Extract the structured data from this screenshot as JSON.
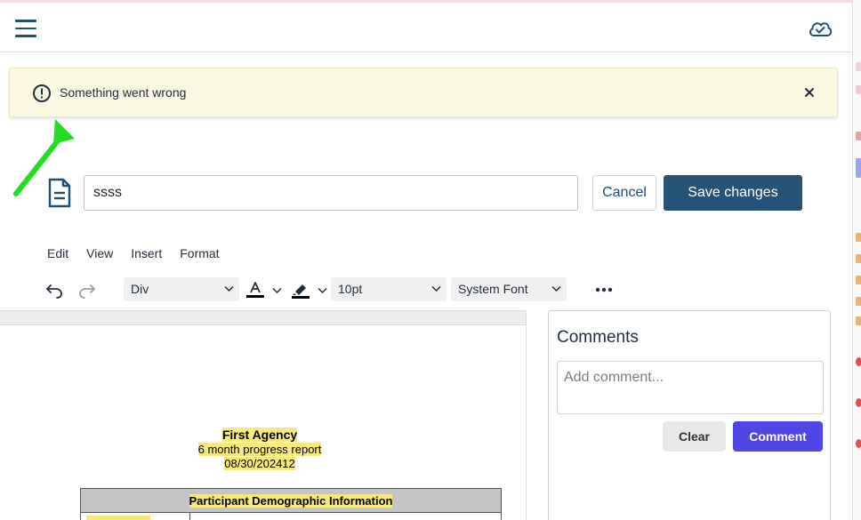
{
  "alert": {
    "message": "Something went wrong"
  },
  "editor": {
    "title_value": "ssss",
    "cancel_label": "Cancel",
    "save_label": "Save changes"
  },
  "menu": {
    "items": [
      "Edit",
      "View",
      "Insert",
      "Format"
    ]
  },
  "toolbar": {
    "block_format": "Div",
    "font_size": "10pt",
    "font_family": "System Font",
    "text_color": "#000000",
    "highlight_color": "#000000"
  },
  "document": {
    "heading": "First Agency",
    "subtitle": "6 month progress report",
    "date": "08/30/202412",
    "table_header": "Participant Demographic Information",
    "highlight_color": "#f6ea7e"
  },
  "comments": {
    "title": "Comments",
    "placeholder": "Add comment...",
    "clear_label": "Clear",
    "comment_label": "Comment"
  },
  "colors": {
    "primary": "#255378",
    "accent": "#4f46e5",
    "alert_bg": "#fbf8e1",
    "arrow": "#22dd22"
  },
  "icons": [
    "hamburger-menu-icon",
    "cloud-check-icon",
    "alert-exclamation-icon",
    "close-icon",
    "document-icon",
    "undo-icon",
    "redo-icon",
    "text-color-icon",
    "highlighter-icon",
    "more-options-icon"
  ]
}
